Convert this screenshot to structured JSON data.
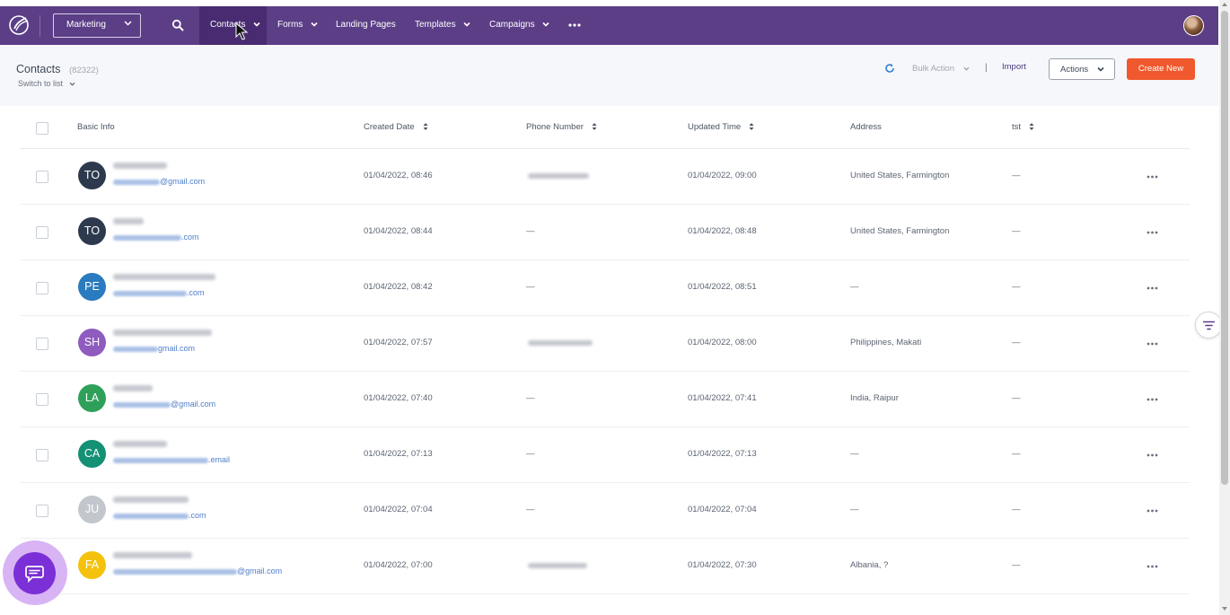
{
  "nav": {
    "workspace": "Marketing",
    "items": [
      {
        "label": "Contacts",
        "active": true
      },
      {
        "label": "Forms"
      },
      {
        "label": "Landing Pages"
      },
      {
        "label": "Templates"
      },
      {
        "label": "Campaigns"
      }
    ]
  },
  "header": {
    "title": "Contacts",
    "count": "(82322)",
    "switch_label": "Switch to list",
    "bulk_action": "Bulk Action",
    "separator": "|",
    "import": "Import",
    "actions": "Actions",
    "create_new": "Create New"
  },
  "table": {
    "columns": [
      "Basic Info",
      "Created Date",
      "Phone Number",
      "Updated Time",
      "Address",
      "tst"
    ],
    "rows": [
      {
        "initials": "TO",
        "color": "#2d3a4d",
        "email_suffix": "@gmail.com",
        "created": "01/04/2022, 08:46",
        "phone": "",
        "updated": "01/04/2022, 09:00",
        "address": "United States, Farmington",
        "tst": "—"
      },
      {
        "initials": "TO",
        "color": "#2d3a4d",
        "email_suffix": ".com",
        "created": "01/04/2022, 08:44",
        "phone": "—",
        "updated": "01/04/2022, 08:48",
        "address": "United States, Farmington",
        "tst": "—"
      },
      {
        "initials": "PE",
        "color": "#2a7bbf",
        "email_suffix": ".com",
        "created": "01/04/2022, 08:42",
        "phone": "—",
        "updated": "01/04/2022, 08:51",
        "address": "—",
        "tst": "—"
      },
      {
        "initials": "SH",
        "color": "#8e5bbf",
        "email_suffix": "gmail.com",
        "created": "01/04/2022, 07:57",
        "phone": "",
        "updated": "01/04/2022, 08:00",
        "address": "Philippines, Makati",
        "tst": "—"
      },
      {
        "initials": "LA",
        "color": "#2fa05a",
        "email_suffix": "@gmail.com",
        "created": "01/04/2022, 07:40",
        "phone": "—",
        "updated": "01/04/2022, 07:41",
        "address": "India, Raipur",
        "tst": "—"
      },
      {
        "initials": "CA",
        "color": "#149075",
        "email_suffix": ".email",
        "created": "01/04/2022, 07:13",
        "phone": "—",
        "updated": "01/04/2022, 07:13",
        "address": "—",
        "tst": "—"
      },
      {
        "initials": "JU",
        "color": "#c3c7cd",
        "email_suffix": ".com",
        "created": "01/04/2022, 07:04",
        "phone": "—",
        "updated": "01/04/2022, 07:04",
        "address": "—",
        "tst": "—"
      },
      {
        "initials": "FA",
        "color": "#f4c20d",
        "email_suffix": "@gmail.com",
        "created": "01/04/2022, 07:00",
        "phone": "",
        "updated": "01/04/2022, 07:30",
        "address": "Albania, ?",
        "tst": "—"
      }
    ]
  },
  "icons": {
    "logo": "logo-icon",
    "search": "search-icon",
    "more": "more-horizontal-icon",
    "refresh": "refresh-icon",
    "filter": "filter-icon",
    "chat": "chat-icon",
    "sort": "sort-icon"
  },
  "colors": {
    "topbar": "#5b3e86",
    "topbar_active": "#482b70",
    "primary_button": "#f0582d",
    "chat_fab": "#7b2fd6",
    "link": "#4f7fc9"
  }
}
